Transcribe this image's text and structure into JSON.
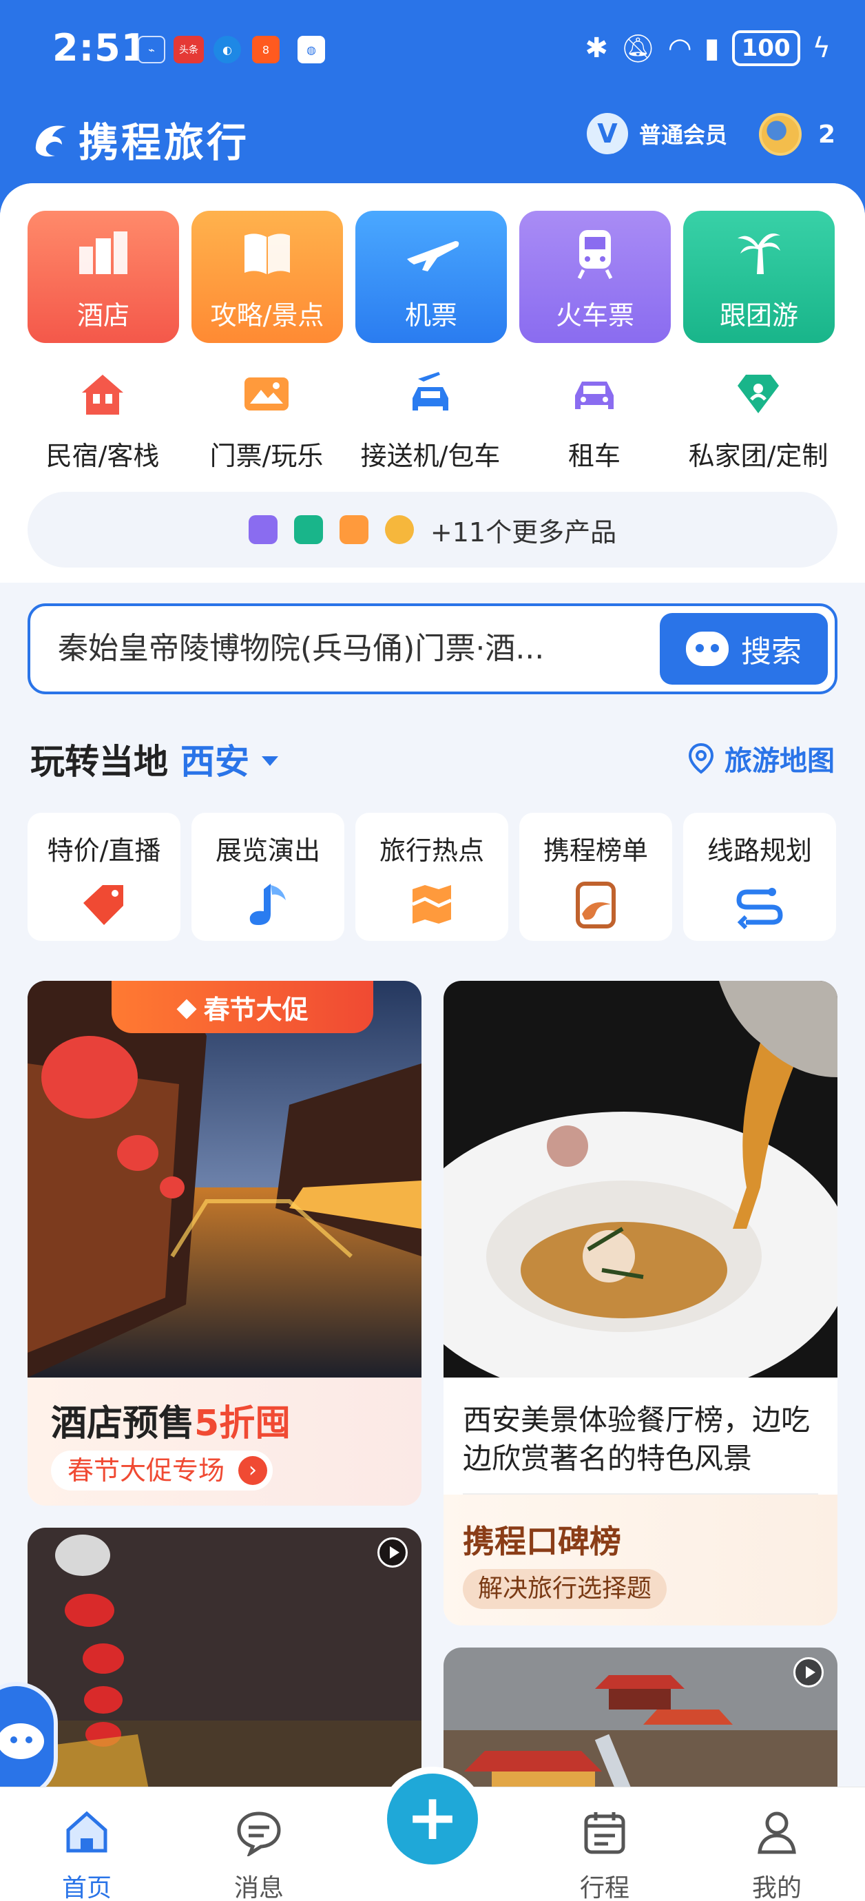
{
  "status_bar": {
    "time": "2:51",
    "apps": [
      "usb-icon",
      "toutiao-icon",
      "browser-icon",
      "app-icon",
      "app-icon"
    ],
    "toutiao_label": "头条",
    "battery": "100"
  },
  "header": {
    "logo_text": "携程旅行",
    "member_badge": "V",
    "member_label": "普通会员",
    "coin_count": "2"
  },
  "big_categories": [
    {
      "label": "酒店",
      "color_from": "#ff8a6a",
      "color_to": "#f4584a"
    },
    {
      "label": "攻略/景点",
      "color_from": "#ffb24d",
      "color_to": "#ff8a33"
    },
    {
      "label": "机票",
      "color_from": "#4aa8ff",
      "color_to": "#2a7cf0"
    },
    {
      "label": "火车票",
      "color_from": "#a98cf5",
      "color_to": "#8a6cf0"
    },
    {
      "label": "跟团游",
      "color_from": "#38d1a7",
      "color_to": "#19b58a"
    }
  ],
  "small_categories": [
    {
      "label": "民宿/客栈",
      "icon": "house-icon"
    },
    {
      "label": "门票/玩乐",
      "icon": "ticket-icon"
    },
    {
      "label": "接送机/包车",
      "icon": "car-plane-icon"
    },
    {
      "label": "租车",
      "icon": "car-icon"
    },
    {
      "label": "私家团/定制",
      "icon": "diamond-icon"
    }
  ],
  "more_products": "+11个更多产品",
  "search": {
    "placeholder": "秦始皇帝陵博物院(兵马俑)门票·酒...",
    "button": "搜索"
  },
  "local": {
    "title": "玩转当地",
    "city": "西安",
    "map_link": "旅游地图"
  },
  "local_tiles": [
    {
      "label": "特价/直播"
    },
    {
      "label": "展览演出"
    },
    {
      "label": "旅行热点"
    },
    {
      "label": "携程榜单"
    },
    {
      "label": "线路规划"
    }
  ],
  "feed": {
    "promo_tag": "春节大促",
    "presale_title_a": "酒店预售",
    "presale_title_b": "5折囤",
    "presale_pill": "春节大促专场",
    "dish_title": "西安美景体验餐厅榜，边吃边欣赏著名的特色风景",
    "koubei_title": "携程口碑榜",
    "koubei_sub": "解决旅行选择题"
  },
  "nav": {
    "home": "首页",
    "messages": "消息",
    "trips": "行程",
    "mine": "我的"
  }
}
